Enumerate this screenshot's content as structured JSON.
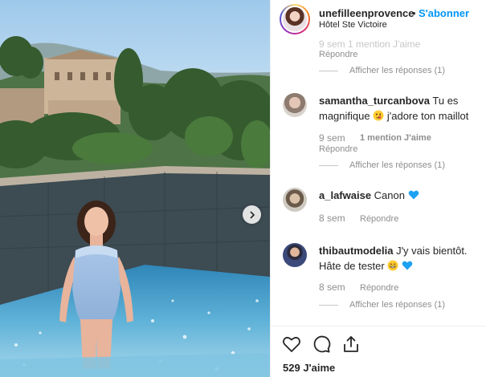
{
  "header": {
    "username": "unefilleenprovence",
    "separator": "•",
    "follow_label": "S'abonner",
    "location": "Hôtel Ste Victoire"
  },
  "top_partial": {
    "meta_text": "9 sem   1 mention J'aime",
    "reply_label": "Répondre",
    "view_replies": "Afficher les réponses (1)"
  },
  "comments": [
    {
      "username": "samantha_turcanbova",
      "text_before_emoji": "Tu es magnifique",
      "emoji": "smirk-face",
      "text_after_emoji": "j'adore ton maillot",
      "time": "9 sem",
      "likes": "1 mention J'aime",
      "reply_label": "Répondre",
      "view_replies": "Afficher les réponses (1)"
    },
    {
      "username": "a_lafwaise",
      "text_before_emoji": "Canon",
      "emoji": "blue-heart",
      "time": "8 sem",
      "reply_label": "Répondre"
    },
    {
      "username": "thibautmodelia",
      "text_before_emoji": "J'y vais bientôt. Hâte de tester",
      "emoji": "grin-face",
      "emoji_2": "blue-heart",
      "time": "8 sem",
      "reply_label": "Répondre",
      "view_replies": "Afficher les réponses (1)"
    }
  ],
  "footer": {
    "likes_count": "529",
    "likes_label": "J'aime",
    "icons": [
      "heart-icon",
      "comment-icon",
      "share-icon"
    ]
  },
  "colors": {
    "follow_blue": "#0095f6",
    "heart_blue": "#1da1f2",
    "muted_text": "#8e8e8e"
  }
}
